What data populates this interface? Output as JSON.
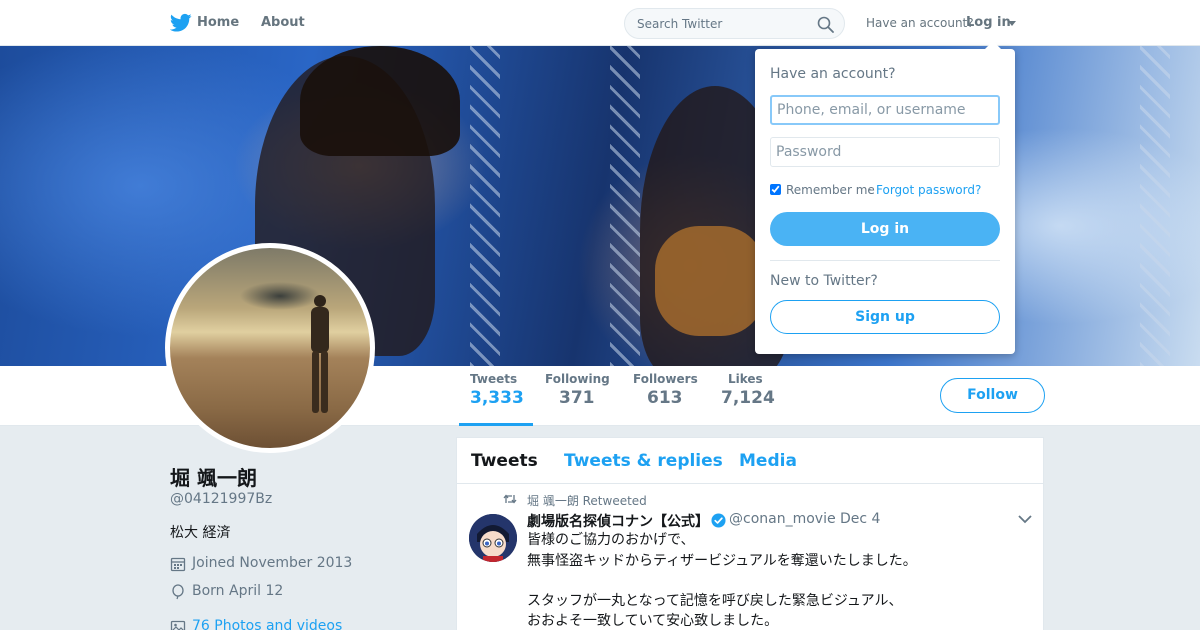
{
  "nav": {
    "home_label": "Home",
    "about_label": "About",
    "search_placeholder": "Search Twitter",
    "have_account_text": "Have an account?",
    "login_label": "Log in",
    "logo_icon": "twitter-bird-icon",
    "search_icon": "search-icon"
  },
  "profile": {
    "name": "堀 颯一朗",
    "handle": "@04121997Bz",
    "bio": "松大 経済",
    "joined": "Joined November 2013",
    "born": "Born April 12",
    "photos": "76 Photos and videos",
    "follow_label": "Follow"
  },
  "stats": [
    {
      "label": "Tweets",
      "value": "3,333"
    },
    {
      "label": "Following",
      "value": "371"
    },
    {
      "label": "Followers",
      "value": "613"
    },
    {
      "label": "Likes",
      "value": "7,124"
    }
  ],
  "timeline": {
    "tabs": [
      "Tweets",
      "Tweets & replies",
      "Media"
    ],
    "tweet": {
      "retweeted_by": "堀 颯一朗 Retweeted",
      "author": "劇場版名探偵コナン【公式】",
      "screen_name": "@conan_movie",
      "separator": "·",
      "date": "Dec 4",
      "lines": [
        "皆様のご協力のおかげで、",
        "無事怪盗キッドからティザービジュアルを奪還いたしました。",
        "",
        "スタッフが一丸となって記憶を呼び戻した緊急ビジュアル、",
        "おおよそ一致していて安心致しました。"
      ]
    }
  },
  "login_dropdown": {
    "title": "Have an account?",
    "username_placeholder": "Phone, email, or username",
    "password_placeholder": "Password",
    "remember_label": "Remember me",
    "separator": "·",
    "forgot_label": "Forgot password?",
    "login_button": "Log in",
    "new_text": "New to Twitter?",
    "signup_button": "Sign up"
  },
  "colors": {
    "accent": "#1da1f2",
    "login_button": "#4ab3f4",
    "muted_text": "#657786",
    "page_bg": "#e6ecf0"
  }
}
